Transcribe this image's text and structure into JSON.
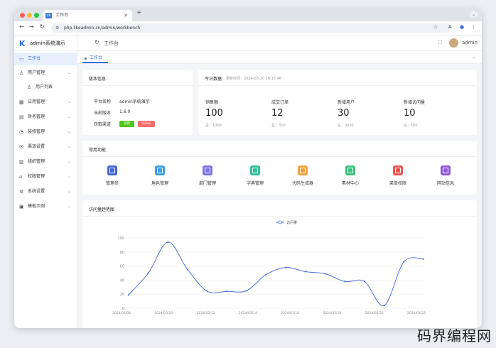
{
  "browser": {
    "tab_title": "工作台",
    "favicon": "LK",
    "url": "php.likeadmin.cn/admin/workbench"
  },
  "sidebar": {
    "brand": "admin系统演示",
    "items": [
      {
        "label": "工作台",
        "icon": "monitor-icon",
        "active": true,
        "expand": false
      },
      {
        "label": "用户管理",
        "icon": "user-icon",
        "active": false,
        "expand": true
      },
      {
        "label": "用户列表",
        "icon": "user-icon",
        "active": false,
        "expand": false,
        "sub": true
      },
      {
        "label": "应用管理",
        "icon": "app-icon",
        "active": false,
        "expand": true
      },
      {
        "label": "财务管理",
        "icon": "finance-icon",
        "active": false,
        "expand": true
      },
      {
        "label": "装修管理",
        "icon": "decorate-icon",
        "active": false,
        "expand": true
      },
      {
        "label": "渠道设置",
        "icon": "channel-icon",
        "active": false,
        "expand": true
      },
      {
        "label": "组织管理",
        "icon": "org-icon",
        "active": false,
        "expand": true
      },
      {
        "label": "权限管理",
        "icon": "lock-icon",
        "active": false,
        "expand": true
      },
      {
        "label": "系统设置",
        "icon": "gear-icon",
        "active": false,
        "expand": true
      },
      {
        "label": "模板示例",
        "icon": "template-icon",
        "active": false,
        "expand": true
      }
    ]
  },
  "header": {
    "breadcrumb": "工作台",
    "user": "admin"
  },
  "tabs": [
    {
      "label": "工作台"
    }
  ],
  "version": {
    "title": "版本信息",
    "rows": [
      {
        "k": "平台名称",
        "v": "admin系统演示"
      },
      {
        "k": "当前版本",
        "v": "1.6.0"
      },
      {
        "k": "获取渠道",
        "v": ""
      }
    ],
    "btn_official": "官网",
    "btn_gitee": "Gitee"
  },
  "today": {
    "title": "今日数据",
    "updated": "更新时间：2024-03-20 16:17:46",
    "stats": [
      {
        "label": "销售额",
        "value": "100",
        "total": "总：1000"
      },
      {
        "label": "成交订单",
        "value": "12",
        "total": "总：350"
      },
      {
        "label": "新增用户",
        "value": "30",
        "total": "总：3000"
      },
      {
        "label": "新增访问量",
        "value": "10",
        "total": "总：100"
      }
    ]
  },
  "functions": {
    "title": "常用功能",
    "items": [
      {
        "label": "管理员",
        "icon": "admin-icon",
        "color": "#3e63d8"
      },
      {
        "label": "角色管理",
        "icon": "role-icon",
        "color": "#3aa0e0"
      },
      {
        "label": "部门管理",
        "icon": "department-icon",
        "color": "#7b6ee6"
      },
      {
        "label": "字典管理",
        "icon": "dictionary-icon",
        "color": "#2fbf9a"
      },
      {
        "label": "代码生成器",
        "icon": "code-icon",
        "color": "#f0a23b"
      },
      {
        "label": "素材中心",
        "icon": "material-icon",
        "color": "#3cc07a"
      },
      {
        "label": "菜单权限",
        "icon": "menu-icon",
        "color": "#ef5350"
      },
      {
        "label": "网站信息",
        "icon": "website-icon",
        "color": "#8e57d8"
      }
    ]
  },
  "chart_data": {
    "type": "line",
    "title": "访问量趋势图",
    "series": [
      {
        "name": "访问量",
        "values": [
          19,
          50,
          94,
          55,
          24,
          24,
          25,
          48,
          58,
          52,
          49,
          38,
          38,
          4,
          66,
          70
        ]
      }
    ],
    "x_ticks": [
      "2024/03/08",
      "2024/03/10",
      "2024/03/12",
      "2024/03/14",
      "2024/03/16",
      "2024/03/18",
      "2024/03/20",
      "2024/03/22"
    ],
    "ylim": [
      0,
      100
    ],
    "y_ticks": [
      0,
      20,
      40,
      60,
      80,
      100
    ],
    "legend": "top-center",
    "grid": true,
    "color": "#4a6fd8"
  },
  "watermark": "码界编程网"
}
